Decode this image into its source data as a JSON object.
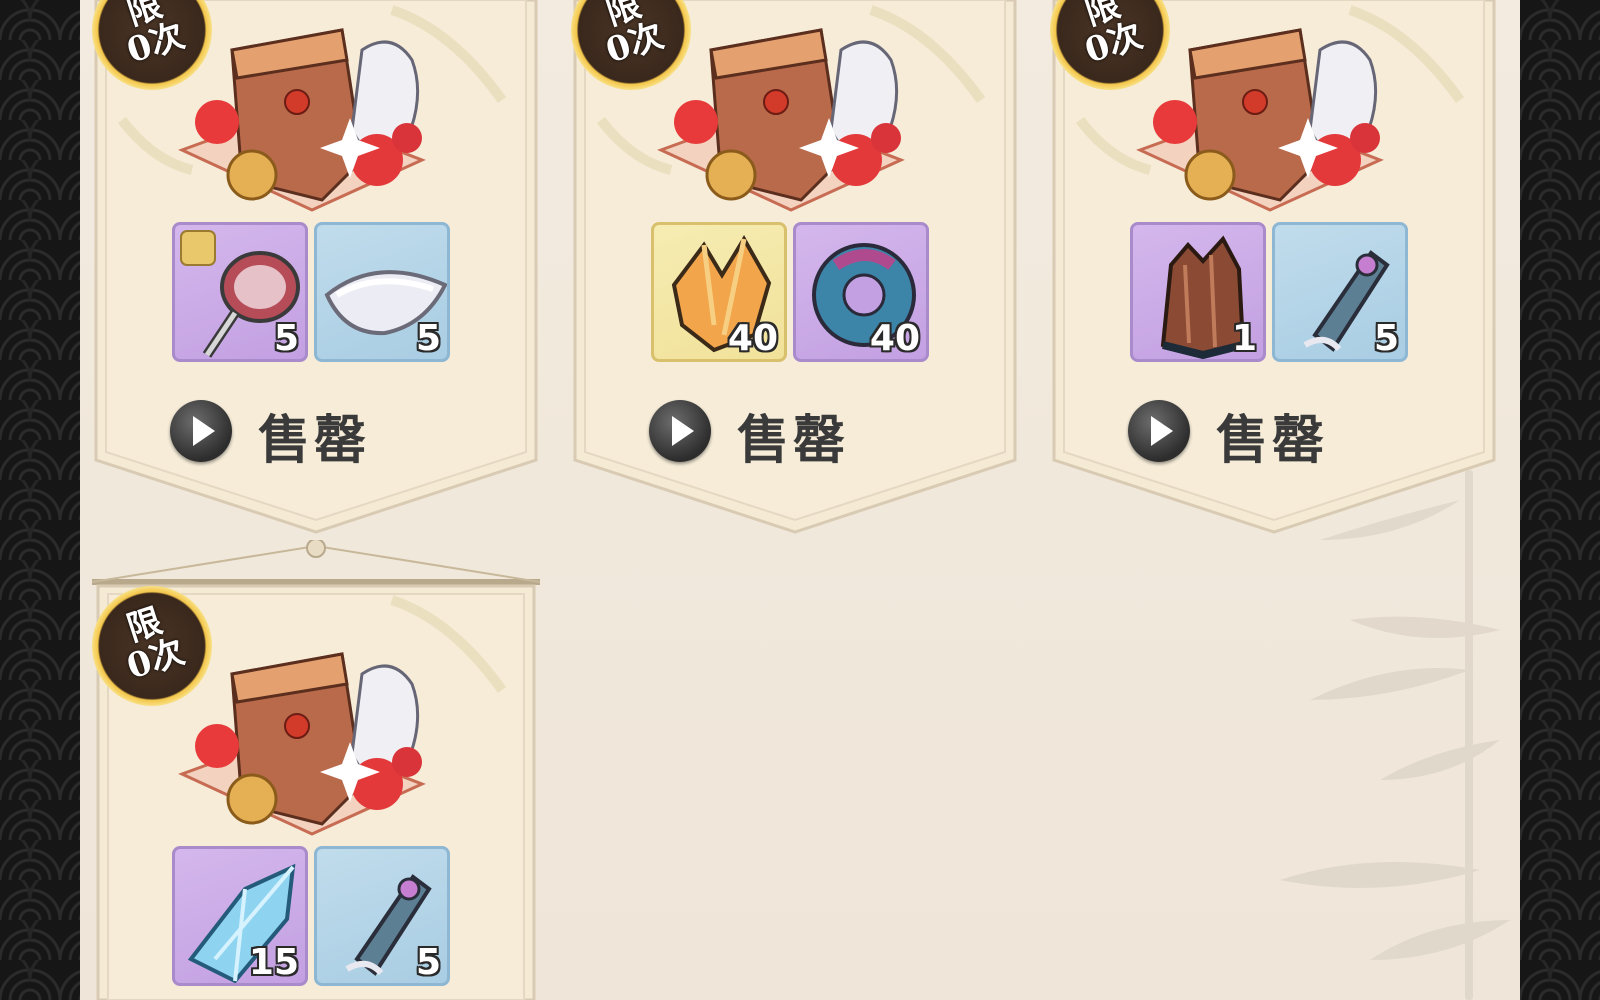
{
  "shop": {
    "packs": [
      {
        "limit_label": "限\n0次",
        "items": [
          {
            "icon": "hand-mirror-shard-icon",
            "qty": "5",
            "rarity": "purple"
          },
          {
            "icon": "silver-ingot-icon",
            "qty": "5",
            "rarity": "blue"
          }
        ],
        "status": "售罄"
      },
      {
        "limit_label": "限\n0次",
        "items": [
          {
            "icon": "orange-crystal-icon",
            "qty": "40",
            "rarity": "gold"
          },
          {
            "icon": "jade-ring-icon",
            "qty": "40",
            "rarity": "purple"
          }
        ],
        "status": "售罄"
      },
      {
        "limit_label": "限\n0次",
        "items": [
          {
            "icon": "tree-stump-icon",
            "qty": "1",
            "rarity": "purple"
          },
          {
            "icon": "scroll-talisman-icon",
            "qty": "5",
            "rarity": "blue"
          }
        ],
        "status": "售罄"
      },
      {
        "limit_label": "限\n0次",
        "items": [
          {
            "icon": "blue-crystal-icon",
            "qty": "15",
            "rarity": "purple"
          },
          {
            "icon": "scroll-talisman-icon",
            "qty": "5",
            "rarity": "blue"
          }
        ],
        "status": ""
      }
    ]
  },
  "colors": {
    "purple_tile": "#c8a8e6",
    "blue_tile": "#b2d4e8",
    "gold_tile": "#f3e6a4",
    "panel_bg": "#f2e9dd",
    "badge_gold": "#f4c64a"
  }
}
